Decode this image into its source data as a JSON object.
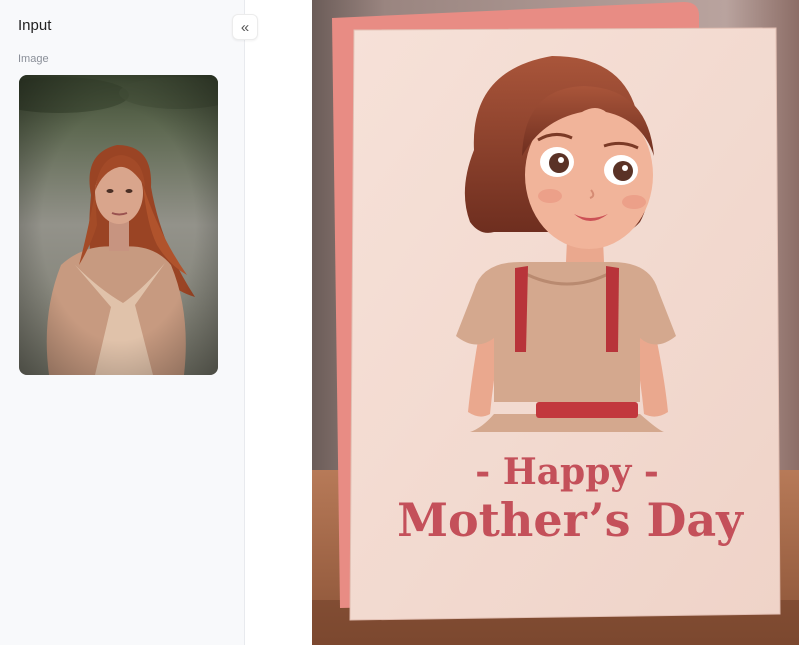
{
  "panel": {
    "title": "Input",
    "collapse_icon": "double-chevron-left-icon",
    "collapse_glyph": "«",
    "image_field_label": "Image"
  },
  "result": {
    "card_line1": "- Happy -",
    "card_line2": "Mother’s Day"
  },
  "colors": {
    "panel_bg": "#f8f9fb",
    "card_face": "#f7e0d8",
    "card_back": "#e88c84",
    "title_text": "#c4505a"
  }
}
